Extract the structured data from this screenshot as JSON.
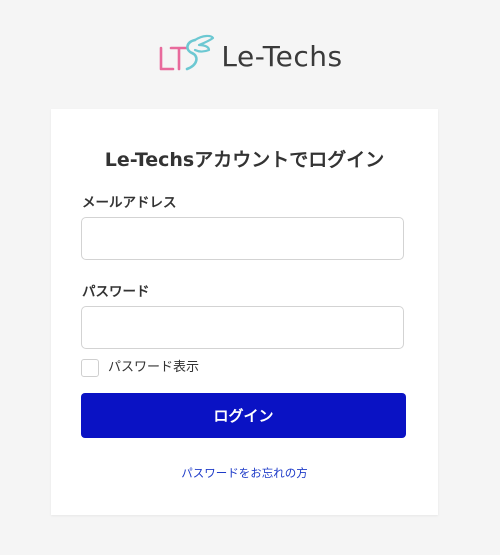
{
  "brand": {
    "name": "Le-Techs",
    "mark_colors": {
      "pink": "#e86a9c",
      "teal": "#6cc8d2"
    }
  },
  "form": {
    "title": "Le-Techsアカウントでログイン",
    "email": {
      "label": "メールアドレス",
      "value": "",
      "placeholder": ""
    },
    "password": {
      "label": "パスワード",
      "value": "",
      "placeholder": ""
    },
    "show_password": {
      "label": "パスワード表示",
      "checked": false
    },
    "submit_label": "ログイン",
    "forgot_link": "パスワードをお忘れの方"
  },
  "colors": {
    "background": "#f5f5f5",
    "card": "#ffffff",
    "primary_button": "#0a12c4",
    "link": "#1e3bc8",
    "text": "#333333"
  }
}
